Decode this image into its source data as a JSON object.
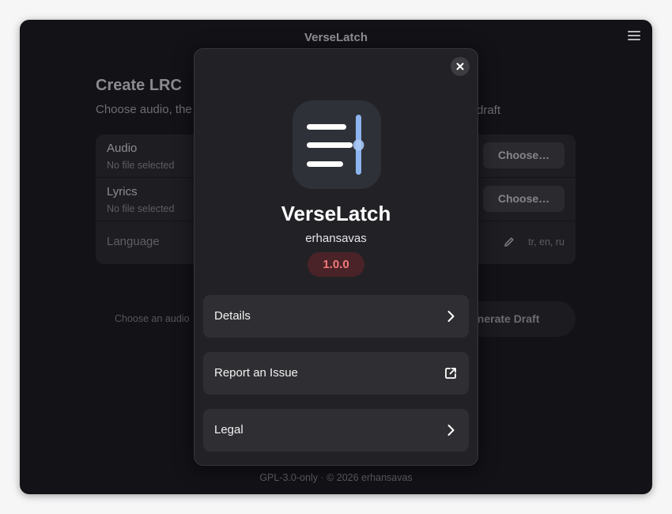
{
  "window": {
    "title": "VerseLatch"
  },
  "background": {
    "title": "Create LRC",
    "subtitle_start": "Choose audio, the",
    "subtitle_end": "draft",
    "audio": {
      "label": "Audio",
      "status": "No file selected",
      "button": "Choose…"
    },
    "lyrics": {
      "label": "Lyrics",
      "status": "No file selected",
      "button": "Choose…"
    },
    "language": {
      "label": "Language",
      "codes": "tr, en, ru",
      "icon": "pencil-icon"
    },
    "status_text": "Choose an audio",
    "generate_button": "enerate Draft",
    "footer": "GPL-3.0-only · © 2026 erhansavas"
  },
  "about": {
    "app_name": "VerseLatch",
    "developer": "erhansavas",
    "version": "1.0.0",
    "rows": [
      {
        "label": "Details",
        "icon": "chevron-right-icon"
      },
      {
        "label": "Report an Issue",
        "icon": "external-link-icon"
      },
      {
        "label": "Legal",
        "icon": "chevron-right-icon"
      }
    ]
  },
  "colors": {
    "accent_blue": "#8cb4f0",
    "version_text": "#f07878",
    "version_bg": "#4a2328",
    "dialog_bg": "#222226",
    "window_bg": "#121217"
  }
}
